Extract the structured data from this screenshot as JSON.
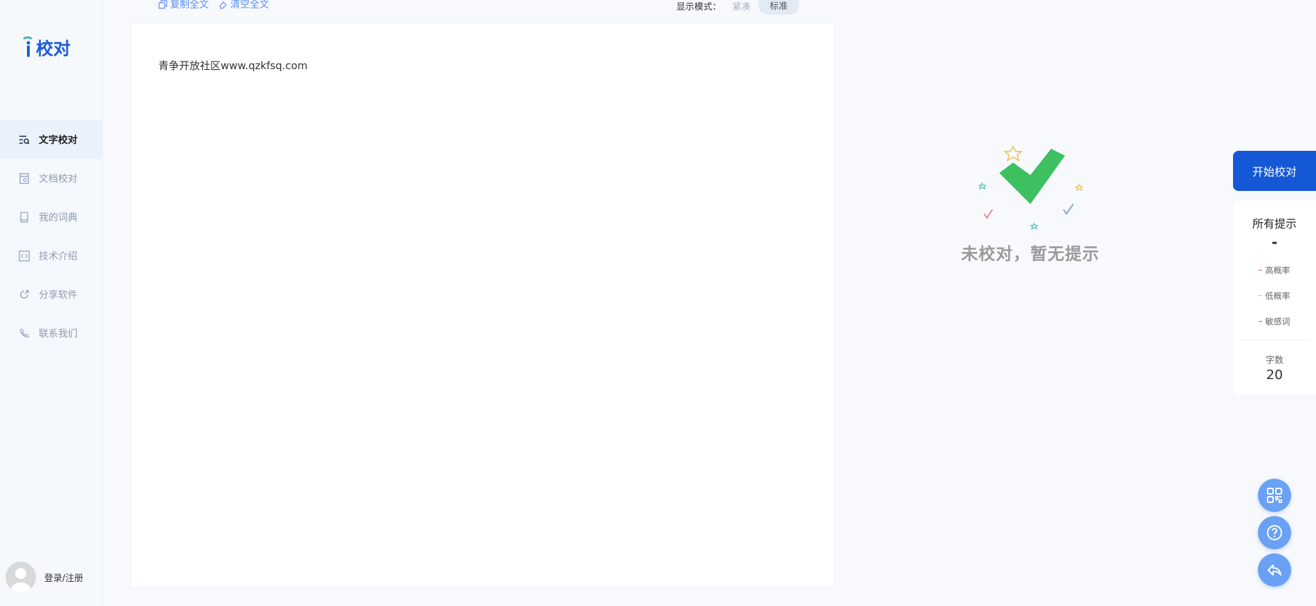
{
  "sidebar": {
    "logo_text": "校对",
    "items": [
      {
        "label": "文字校对",
        "icon": "text-search-icon",
        "active": true
      },
      {
        "label": "文档校对",
        "icon": "document-check-icon"
      },
      {
        "label": "我的词典",
        "icon": "book-icon"
      },
      {
        "label": "技术介绍",
        "icon": "code-icon"
      },
      {
        "label": "分享软件",
        "icon": "share-icon"
      },
      {
        "label": "联系我们",
        "icon": "phone-icon"
      }
    ],
    "user_label": "登录/注册"
  },
  "toolbar": {
    "copy_label": "复制全文",
    "clear_label": "清空全文",
    "mode_label": "显示模式：",
    "mode_options": [
      "紧凑",
      "标准"
    ],
    "mode_selected": "标准"
  },
  "editor": {
    "text": "青争开放社区www.qzkfsq.com"
  },
  "empty_state": {
    "text": "未校对，暂无提示"
  },
  "panel": {
    "start_button": "开始校对",
    "all_hints_label": "所有提示",
    "all_hints_value": "-",
    "categories": [
      {
        "label": "高概率",
        "color": "#e05a5a"
      },
      {
        "label": "低概率",
        "color": "#f0b429"
      },
      {
        "label": "敏感词",
        "color": "#7a7a7a"
      }
    ],
    "word_count_label": "字数",
    "word_count": "20"
  },
  "colors": {
    "accent": "#1558d6",
    "check_green": "#3cc060",
    "fab": "#6aa1f5"
  }
}
